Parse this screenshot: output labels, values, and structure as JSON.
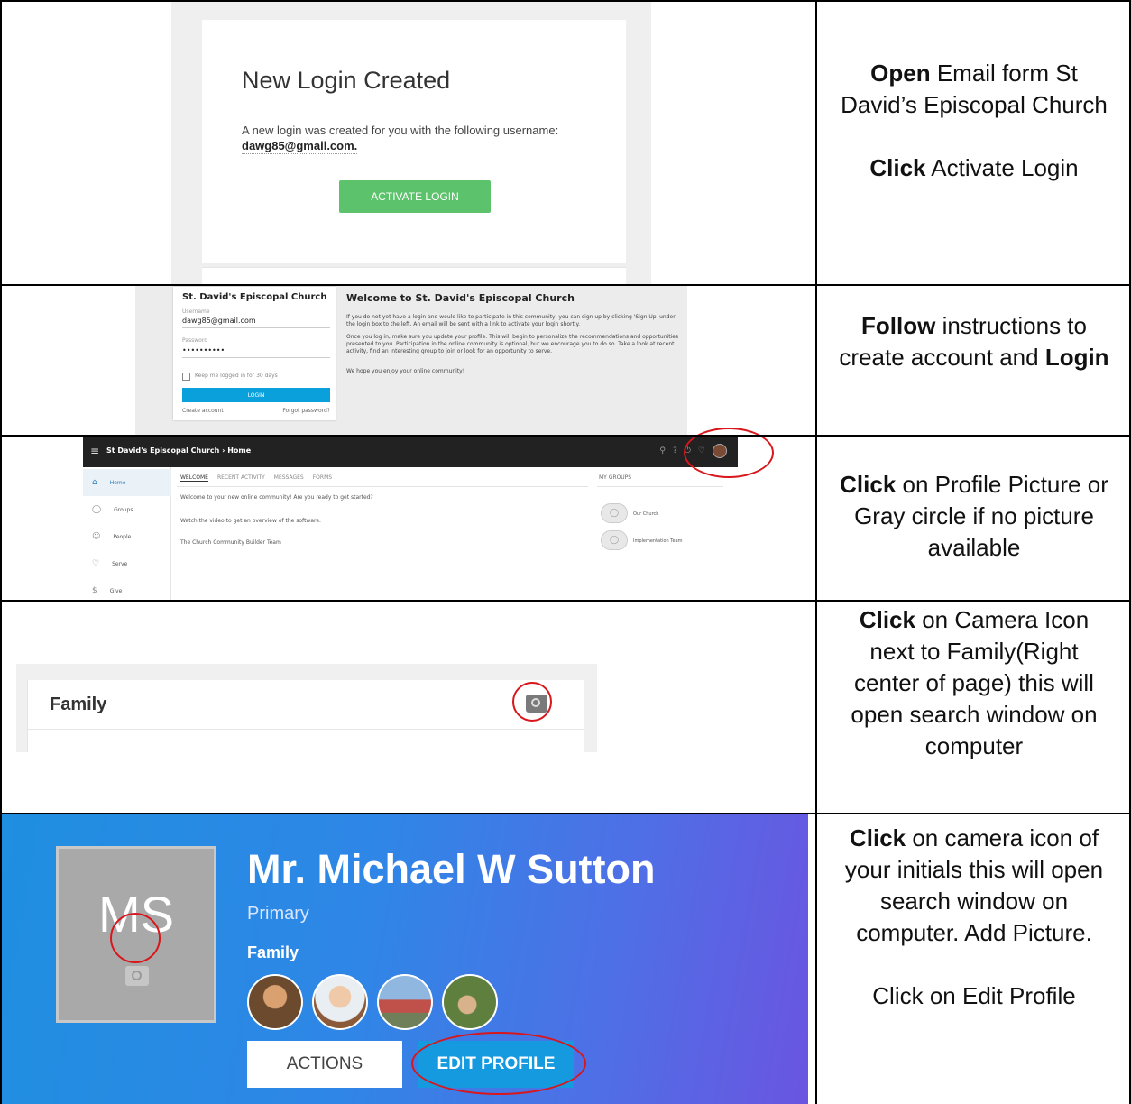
{
  "rows": [
    {
      "instructions": [
        {
          "strong": "Open",
          "text": " Email form St David’s Episcopal Church"
        },
        {
          "strong": "Click",
          "text": " Activate Login"
        }
      ]
    },
    {
      "instructions": [
        {
          "strong": "Follow",
          "text": " instructions to create account and "
        },
        {
          "strong": "Login",
          "text": ""
        }
      ]
    },
    {
      "instructions": [
        {
          "strong": "Click",
          "text": " on Profile Picture or Gray circle if no picture available"
        }
      ]
    },
    {
      "instructions": [
        {
          "strong": "Click",
          "text": " on Camera Icon next to Family(Right center of page) this will open search window on computer"
        }
      ]
    },
    {
      "instructions": [
        {
          "strong": "Click",
          "text": " on camera icon of your initials this will open search window on computer. Add Picture."
        },
        {
          "strong": "",
          "text": "Click on Edit Profile"
        }
      ]
    }
  ],
  "email": {
    "title": "New Login Created",
    "body": "A new login was created for you with the following username:",
    "username": "dawg85@gmail.com",
    "username_suffix": ".",
    "button": "ACTIVATE LOGIN"
  },
  "login": {
    "church": "St. David's Episcopal Church",
    "username_label": "Username",
    "username_value": "dawg85@gmail.com",
    "password_label": "Password",
    "password_value": "••••••••••",
    "keep_logged": "Keep me logged in for 30 days",
    "button": "LOGIN",
    "create": "Create account",
    "forgot": "Forgot password?",
    "welcome_title": "Welcome to St. David's Episcopal Church",
    "welcome_p1": "If you do not yet have a login and would like to participate in this community, you can sign up by clicking 'Sign Up' under the login box to the left. An email will be sent with a link to activate your login shortly.",
    "welcome_p2": "Once you log in, make sure you update your profile. This will begin to personalize the recommendations and opportunities presented to you. Participation in the online community is optional, but we encourage you to do so. Take a look at recent activity, find an interesting group to join or look for an opportunity to serve.",
    "welcome_p3": "We hope you enjoy your online community!"
  },
  "dashboard": {
    "title": "St David's Episcopal Church › Home",
    "sidebar": [
      "Home",
      "Groups",
      "People",
      "Serve",
      "Give"
    ],
    "sidebar_icons": [
      "home-icon",
      "groups-icon",
      "people-icon",
      "serve-icon",
      "give-icon"
    ],
    "tabs": [
      "WELCOME",
      "RECENT ACTIVITY",
      "MESSAGES",
      "FORMS"
    ],
    "lines": [
      "Welcome to your new online community! Are you ready to get started?",
      "Watch the video to get an overview of the software.",
      "The Church Community Builder Team"
    ],
    "my_groups_label": "MY GROUPS",
    "groups": [
      "Our Church",
      "Implementation Team"
    ]
  },
  "family": {
    "title": "Family"
  },
  "profile": {
    "initials": "MS",
    "name": "Mr. Michael W Sutton",
    "role": "Primary",
    "family_label": "Family",
    "actions": "ACTIONS",
    "edit": "EDIT PROFILE"
  },
  "colors": {
    "activate_green": "#5cc26b",
    "login_blue": "#0aa0dc",
    "highlight_red": "#d8161b",
    "edit_blue": "#159ae0"
  }
}
